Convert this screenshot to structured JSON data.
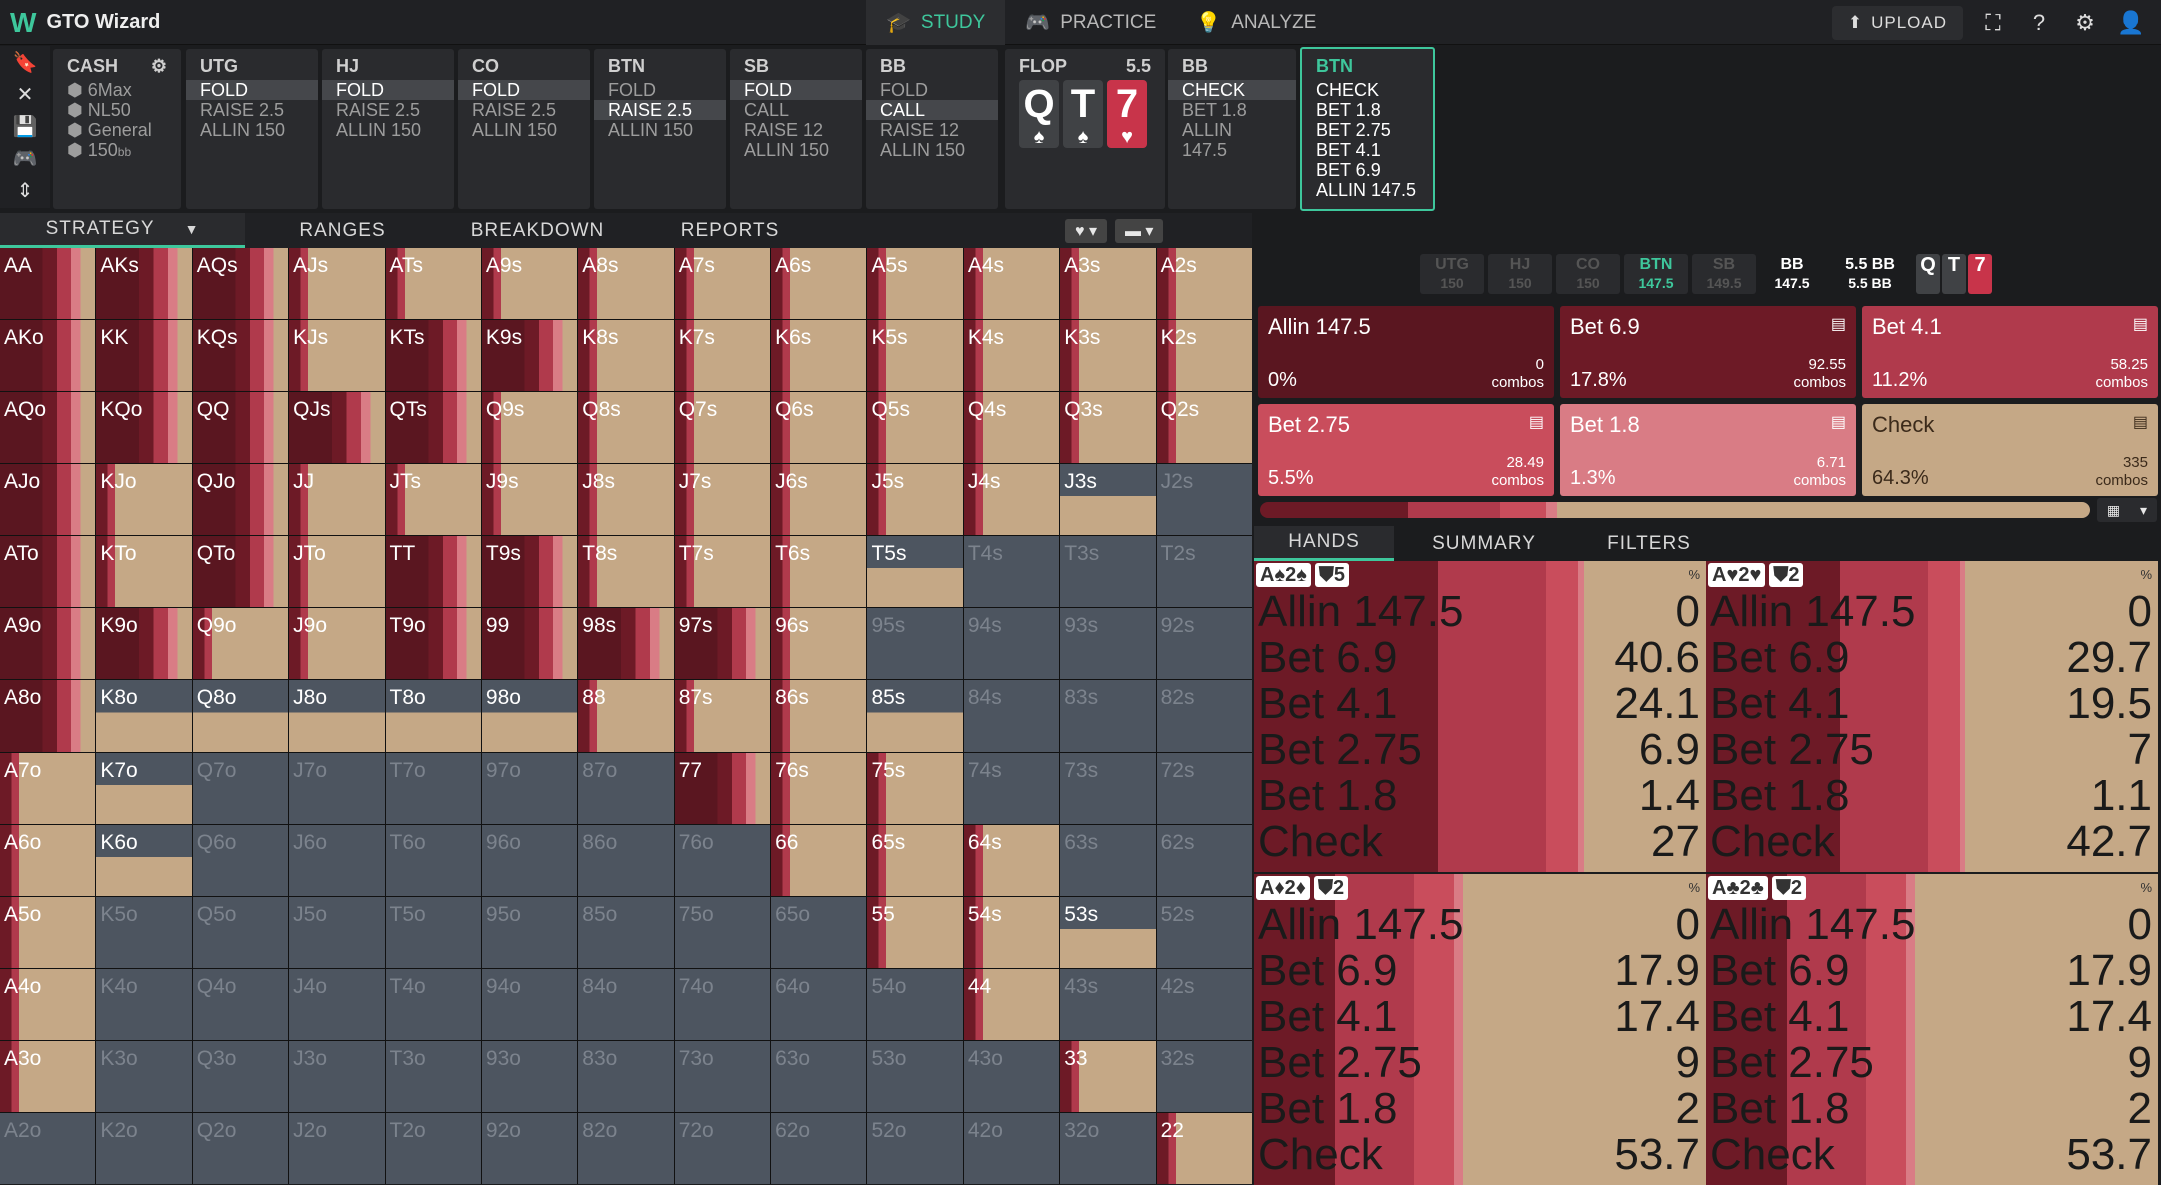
{
  "app": {
    "logo": "W",
    "title": "GTO Wizard"
  },
  "nav": [
    {
      "label": "STUDY",
      "icon": "🎓"
    },
    {
      "label": "PRACTICE",
      "icon": "🎮"
    },
    {
      "label": "ANALYZE",
      "icon": "💡"
    }
  ],
  "top_right": {
    "upload": "UPLOAD"
  },
  "game": {
    "title": "CASH",
    "lines": [
      "6Max",
      "NL50",
      "General",
      "150"
    ],
    "bb": "bb"
  },
  "players": [
    {
      "name": "UTG",
      "actions": [
        "FOLD",
        "RAISE 2.5",
        "ALLIN 150"
      ],
      "sel": 0
    },
    {
      "name": "HJ",
      "actions": [
        "FOLD",
        "RAISE 2.5",
        "ALLIN 150"
      ],
      "sel": 0
    },
    {
      "name": "CO",
      "actions": [
        "FOLD",
        "RAISE 2.5",
        "ALLIN 150"
      ],
      "sel": 0
    },
    {
      "name": "BTN",
      "actions": [
        "FOLD",
        "RAISE 2.5",
        "ALLIN 150"
      ],
      "sel": 1
    },
    {
      "name": "SB",
      "actions": [
        "FOLD",
        "CALL",
        "RAISE 12",
        "ALLIN 150"
      ],
      "sel": 0
    },
    {
      "name": "BB",
      "actions": [
        "FOLD",
        "CALL",
        "RAISE 12",
        "ALLIN 150"
      ],
      "sel": 1
    }
  ],
  "flop": {
    "label": "FLOP",
    "pot": "5.5",
    "cards": [
      {
        "rank": "Q",
        "suit": "♠",
        "color": "#404245"
      },
      {
        "rank": "T",
        "suit": "♠",
        "color": "#404245"
      },
      {
        "rank": "7",
        "suit": "♥",
        "color": "#c8344a"
      }
    ]
  },
  "bb_post": {
    "name": "BB",
    "actions": [
      "CHECK",
      "BET 1.8",
      "ALLIN 147.5"
    ],
    "sel": 0
  },
  "btn_post": {
    "name": "BTN",
    "actions": [
      "CHECK",
      "BET 1.8",
      "BET 2.75",
      "BET 4.1",
      "BET 6.9",
      "ALLIN 147.5"
    ]
  },
  "tabs": [
    "STRATEGY",
    "RANGES",
    "BREAKDOWN",
    "REPORTS"
  ],
  "positions": [
    {
      "n": "UTG",
      "v": "150"
    },
    {
      "n": "HJ",
      "v": "150"
    },
    {
      "n": "CO",
      "v": "150"
    },
    {
      "n": "BTN",
      "v": "147.5"
    },
    {
      "n": "SB",
      "v": "149.5"
    },
    {
      "n": "BB",
      "v": "147.5"
    }
  ],
  "pot": {
    "a": "5.5 BB",
    "b": "5.5 BB"
  },
  "actions": [
    {
      "label": "Allin 147.5",
      "pct": "0%",
      "combos": "0",
      "color": "#5a1620"
    },
    {
      "label": "Bet 6.9",
      "pct": "17.8%",
      "combos": "92.55",
      "color": "#6d1a26"
    },
    {
      "label": "Bet 4.1",
      "pct": "11.2%",
      "combos": "58.25",
      "color": "#b03a4c"
    },
    {
      "label": "Bet 2.75",
      "pct": "5.5%",
      "combos": "28.49",
      "color": "#c94d5c"
    },
    {
      "label": "Bet 1.8",
      "pct": "1.3%",
      "combos": "6.71",
      "color": "#d97c85"
    },
    {
      "label": "Check",
      "pct": "64.3%",
      "combos": "335",
      "color": "#c5a886"
    }
  ],
  "combos_word": "combos",
  "subtabs": [
    "HANDS",
    "SUMMARY",
    "FILTERS"
  ],
  "hands": [
    {
      "combo": "A♠2♠",
      "badge": "5",
      "rows": [
        [
          "Allin 147.5",
          "0"
        ],
        [
          "Bet 6.9",
          "40.6"
        ],
        [
          "Bet 4.1",
          "24.1"
        ],
        [
          "Bet 2.75",
          "6.9"
        ],
        [
          "Bet 1.8",
          "1.4"
        ],
        [
          "Check",
          "27"
        ]
      ]
    },
    {
      "combo": "A♥2♥",
      "badge": "2",
      "rows": [
        [
          "Allin 147.5",
          "0"
        ],
        [
          "Bet 6.9",
          "29.7"
        ],
        [
          "Bet 4.1",
          "19.5"
        ],
        [
          "Bet 2.75",
          "7"
        ],
        [
          "Bet 1.8",
          "1.1"
        ],
        [
          "Check",
          "42.7"
        ]
      ]
    },
    {
      "combo": "A♦2♦",
      "badge": "2",
      "rows": [
        [
          "Allin 147.5",
          "0"
        ],
        [
          "Bet 6.9",
          "17.9"
        ],
        [
          "Bet 4.1",
          "17.4"
        ],
        [
          "Bet 2.75",
          "9"
        ],
        [
          "Bet 1.8",
          "2"
        ],
        [
          "Check",
          "53.7"
        ]
      ]
    },
    {
      "combo": "A♣2♣",
      "badge": "2",
      "rows": [
        [
          "Allin 147.5",
          "0"
        ],
        [
          "Bet 6.9",
          "17.9"
        ],
        [
          "Bet 4.1",
          "17.4"
        ],
        [
          "Bet 2.75",
          "9"
        ],
        [
          "Bet 1.8",
          "2"
        ],
        [
          "Check",
          "53.7"
        ]
      ]
    }
  ],
  "grid_hands": [
    [
      "AA",
      "AKs",
      "AQs",
      "AJs",
      "ATs",
      "A9s",
      "A8s",
      "A7s",
      "A6s",
      "A5s",
      "A4s",
      "A3s",
      "A2s"
    ],
    [
      "AKo",
      "KK",
      "KQs",
      "KJs",
      "KTs",
      "K9s",
      "K8s",
      "K7s",
      "K6s",
      "K5s",
      "K4s",
      "K3s",
      "K2s"
    ],
    [
      "AQo",
      "KQo",
      "QQ",
      "QJs",
      "QTs",
      "Q9s",
      "Q8s",
      "Q7s",
      "Q6s",
      "Q5s",
      "Q4s",
      "Q3s",
      "Q2s"
    ],
    [
      "AJo",
      "KJo",
      "QJo",
      "JJ",
      "JTs",
      "J9s",
      "J8s",
      "J7s",
      "J6s",
      "J5s",
      "J4s",
      "J3s",
      "J2s"
    ],
    [
      "ATo",
      "KTo",
      "QTo",
      "JTo",
      "TT",
      "T9s",
      "T8s",
      "T7s",
      "T6s",
      "T5s",
      "T4s",
      "T3s",
      "T2s"
    ],
    [
      "A9o",
      "K9o",
      "Q9o",
      "J9o",
      "T9o",
      "99",
      "98s",
      "97s",
      "96s",
      "95s",
      "94s",
      "93s",
      "92s"
    ],
    [
      "A8o",
      "K8o",
      "Q8o",
      "J8o",
      "T8o",
      "98o",
      "88",
      "87s",
      "86s",
      "85s",
      "84s",
      "83s",
      "82s"
    ],
    [
      "A7o",
      "K7o",
      "Q7o",
      "J7o",
      "T7o",
      "97o",
      "87o",
      "77",
      "76s",
      "75s",
      "74s",
      "73s",
      "72s"
    ],
    [
      "A6o",
      "K6o",
      "Q6o",
      "J6o",
      "T6o",
      "96o",
      "86o",
      "76o",
      "66",
      "65s",
      "64s",
      "63s",
      "62s"
    ],
    [
      "A5o",
      "K5o",
      "Q5o",
      "J5o",
      "T5o",
      "95o",
      "85o",
      "75o",
      "65o",
      "55",
      "54s",
      "53s",
      "52s"
    ],
    [
      "A4o",
      "K4o",
      "Q4o",
      "J4o",
      "T4o",
      "94o",
      "84o",
      "74o",
      "64o",
      "54o",
      "44",
      "43s",
      "42s"
    ],
    [
      "A3o",
      "K3o",
      "Q3o",
      "J3o",
      "T3o",
      "93o",
      "83o",
      "73o",
      "63o",
      "53o",
      "43o",
      "33",
      "32s"
    ],
    [
      "A2o",
      "K2o",
      "Q2o",
      "J2o",
      "T2o",
      "92o",
      "82o",
      "72o",
      "62o",
      "52o",
      "42o",
      "32o",
      "22"
    ]
  ]
}
